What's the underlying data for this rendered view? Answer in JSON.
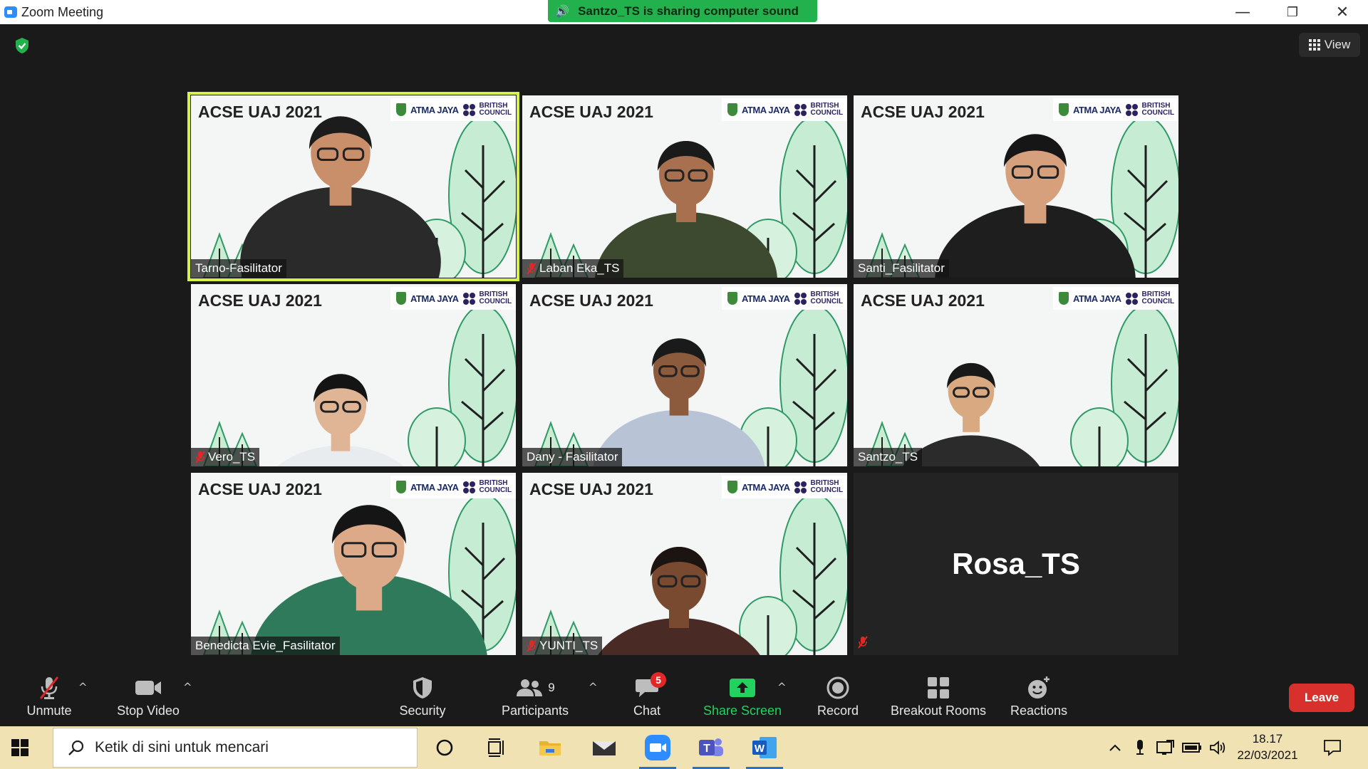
{
  "window": {
    "title": "Zoom Meeting",
    "controls": {
      "minimize": "—",
      "restore": "❐",
      "close": "✕"
    }
  },
  "share_banner": {
    "text": "Santzo_TS is sharing computer sound"
  },
  "top_right": {
    "view_label": "View"
  },
  "background_title": "ACSE UAJ 2021",
  "logos": {
    "atma_jaya": "ATMA JAYA",
    "british_council": "BRITISH COUNCIL",
    "bc_line1": "BRITISH",
    "bc_line2": "COUNCIL"
  },
  "participants": [
    {
      "name": "Tarno-Fasilitator",
      "muted": false,
      "active": true,
      "video": true
    },
    {
      "name": "Laban Eka_TS",
      "muted": true,
      "active": false,
      "video": true
    },
    {
      "name": "Santi_Fasilitator",
      "muted": false,
      "active": false,
      "video": true
    },
    {
      "name": "Vero_TS",
      "muted": true,
      "active": false,
      "video": true
    },
    {
      "name": "Dany - Fasilitator",
      "muted": false,
      "active": false,
      "video": true
    },
    {
      "name": "Santzo_TS",
      "muted": false,
      "active": false,
      "video": true
    },
    {
      "name": "Benedicta Evie_Fasilitator",
      "muted": false,
      "active": false,
      "video": true
    },
    {
      "name": "YUNTI_TS",
      "muted": true,
      "active": false,
      "video": true
    },
    {
      "name": "Rosa_TS",
      "muted": true,
      "active": false,
      "video": false
    }
  ],
  "toolbar": {
    "unmute": "Unmute",
    "stop_video": "Stop Video",
    "security": "Security",
    "participants": "Participants",
    "participants_count": "9",
    "chat": "Chat",
    "chat_badge": "5",
    "share_screen": "Share Screen",
    "record": "Record",
    "breakout_rooms": "Breakout Rooms",
    "reactions": "Reactions",
    "leave": "Leave",
    "caret": "^"
  },
  "taskbar": {
    "search_placeholder": "Ketik di sini untuk mencari",
    "apps": [
      "cortana",
      "task-view",
      "file-explorer",
      "mail",
      "zoom",
      "teams",
      "word"
    ],
    "time": "18.17",
    "date": "22/03/2021"
  },
  "colors": {
    "accent_green": "#23b14d",
    "active_speaker": "#d8f04a",
    "leave_red": "#d8302c",
    "taskbar": "#f1e2b4"
  }
}
